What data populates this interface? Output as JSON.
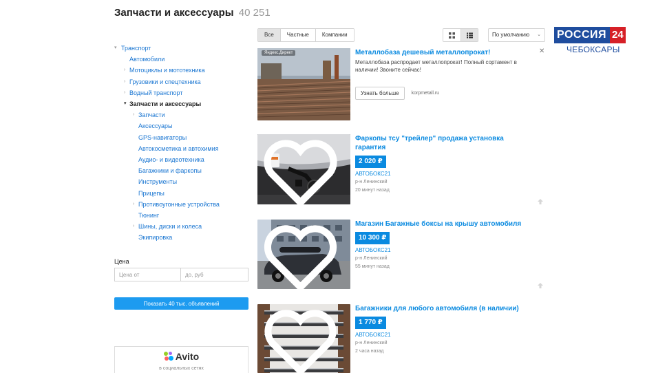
{
  "header": {
    "title": "Запчасти и аксессуары",
    "count": "40 251"
  },
  "sidebar": {
    "categories": [
      {
        "label": "Транспорт",
        "level": 0,
        "arrow": "▾"
      },
      {
        "label": "Автомобили",
        "level": 1,
        "arrow": ""
      },
      {
        "label": "Мотоциклы и мототехника",
        "level": 1,
        "arrow": "›"
      },
      {
        "label": "Грузовики и спецтехника",
        "level": 1,
        "arrow": "›"
      },
      {
        "label": "Водный транспорт",
        "level": 1,
        "arrow": "›"
      },
      {
        "label": "Запчасти и аксессуары",
        "level": 1,
        "arrow": "▾",
        "active": true
      },
      {
        "label": "Запчасти",
        "level": 2,
        "arrow": "›"
      },
      {
        "label": "Аксессуары",
        "level": 2,
        "arrow": ""
      },
      {
        "label": "GPS-навигаторы",
        "level": 2,
        "arrow": ""
      },
      {
        "label": "Автокосметика и автохимия",
        "level": 2,
        "arrow": ""
      },
      {
        "label": "Аудио- и видеотехника",
        "level": 2,
        "arrow": ""
      },
      {
        "label": "Багажники и фаркопы",
        "level": 2,
        "arrow": ""
      },
      {
        "label": "Инструменты",
        "level": 2,
        "arrow": ""
      },
      {
        "label": "Прицепы",
        "level": 2,
        "arrow": ""
      },
      {
        "label": "Противоугонные устройства",
        "level": 2,
        "arrow": "›"
      },
      {
        "label": "Тюнинг",
        "level": 2,
        "arrow": ""
      },
      {
        "label": "Шины, диски и колеса",
        "level": 2,
        "arrow": "›"
      },
      {
        "label": "Экипировка",
        "level": 2,
        "arrow": ""
      }
    ],
    "price": {
      "label": "Цена",
      "from_placeholder": "Цена от",
      "to_placeholder": "до, руб"
    },
    "show_button": "Показать 40 тыс. объявлений",
    "promo": {
      "logo_text": "Avito",
      "caption": "в социальных сетях"
    }
  },
  "toolbar": {
    "tabs": [
      {
        "label": "Все",
        "active": true
      },
      {
        "label": "Частные",
        "active": false
      },
      {
        "label": "Компании",
        "active": false
      }
    ],
    "views": [
      {
        "icon": "grid-view-icon",
        "active": false
      },
      {
        "icon": "list-view-icon",
        "active": true
      }
    ],
    "sort": "По умолчанию"
  },
  "ad": {
    "label": "Яндекс.Директ",
    "title": "Металлобаза дешевый металлопрокат!",
    "description": "Металлобаза распродает металлопрокат! Полный сортамент в наличии! Звоните сейчас!",
    "button": "Узнать больше",
    "domain": "korpmetall.ru"
  },
  "listings": [
    {
      "title": "Фаркопы тсу \"трейлер\" продажа установка гарантия",
      "price": "2 020 ₽",
      "seller": "АВТОБОКС21",
      "location": "р-н Ленинский",
      "time": "20 минут назад"
    },
    {
      "title": "Магазин Багажные боксы на крышу автомобиля",
      "price": "10 300 ₽",
      "seller": "АВТОБОКС21",
      "location": "р-н Ленинский",
      "time": "55 минут назад"
    },
    {
      "title": "Багажники для любого автомобиля (в наличии)",
      "price": "1 770 ₽",
      "seller": "АВТОБОКС21",
      "location": "р-н Ленинский",
      "time": "2 часа назад"
    }
  ],
  "tv": {
    "name": "РОССИЯ",
    "number": "24",
    "city": "ЧЕБОКСАРЫ"
  },
  "colors": {
    "link": "#0a8ae0",
    "sidebar_link": "#1a76d2",
    "button": "#1d9bf0",
    "tv_blue": "#1f4d9e",
    "tv_red": "#d62027"
  }
}
